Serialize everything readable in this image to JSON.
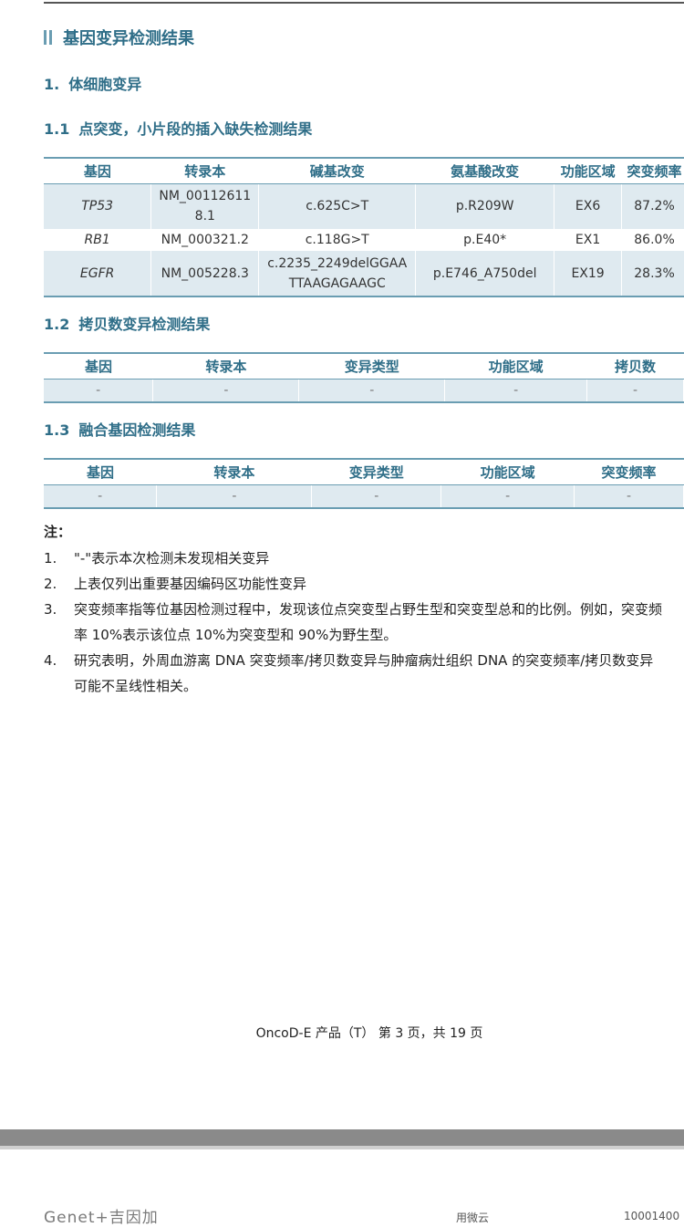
{
  "section_title": "基因变异检测结果",
  "somatic_heading": {
    "num": "1.",
    "label": "体细胞变异"
  },
  "snv": {
    "heading_num": "1.1",
    "heading_label": "点突变，小片段的插入缺失检测结果",
    "headers": [
      "基因",
      "转录本",
      "碱基改变",
      "氨基酸改变",
      "功能区域",
      "突变频率"
    ],
    "rows": [
      {
        "gene": "TP53",
        "transcript_line1": "NM_00112611",
        "transcript_line2": "8.1",
        "base_change_line1": "c.625C>T",
        "base_change_line2": "",
        "aa_change": "p.R209W",
        "region": "EX6",
        "freq": "87.2%"
      },
      {
        "gene": "RB1",
        "transcript_line1": "NM_000321.2",
        "transcript_line2": "",
        "base_change_line1": "c.118G>T",
        "base_change_line2": "",
        "aa_change": "p.E40*",
        "region": "EX1",
        "freq": "86.0%"
      },
      {
        "gene": "EGFR",
        "transcript_line1": "NM_005228.3",
        "transcript_line2": "",
        "base_change_line1": "c.2235_2249delGGAA",
        "base_change_line2": "TTAAGAGAAGC",
        "aa_change": "p.E746_A750del",
        "region": "EX19",
        "freq": "28.3%"
      }
    ]
  },
  "cnv": {
    "heading_num": "1.2",
    "heading_label": "拷贝数变异检测结果",
    "headers": [
      "基因",
      "转录本",
      "变异类型",
      "功能区域",
      "拷贝数"
    ],
    "row": [
      "-",
      "-",
      "-",
      "-",
      "-"
    ]
  },
  "fusion": {
    "heading_num": "1.3",
    "heading_label": "融合基因检测结果",
    "headers": [
      "基因",
      "转录本",
      "变异类型",
      "功能区域",
      "突变频率"
    ],
    "row": [
      "-",
      "-",
      "-",
      "-",
      "-"
    ]
  },
  "notes": {
    "title": "注：",
    "items": [
      {
        "num": "1.",
        "lines": [
          "\"-\"表示本次检测未发现相关变异"
        ]
      },
      {
        "num": "2.",
        "lines": [
          "上表仅列出重要基因编码区功能性变异"
        ]
      },
      {
        "num": "3.",
        "lines": [
          "突变频率指等位基因检测过程中，发现该位点突变型占野生型和突变型总和的比例。例如，突变频",
          "率 10%表示该位点 10%为突变型和 90%为野生型。"
        ]
      },
      {
        "num": "4.",
        "lines": [
          "研究表明，外周血游离 DNA 突变频率/拷贝数变异与肿瘤病灶组织 DNA 的突变频率/拷贝数变异",
          "可能不呈线性相关。"
        ]
      }
    ]
  },
  "footer": "OncoD-E 产品（T） 第 3 页，共 19 页",
  "next_page": {
    "logo": "Genet+吉因加",
    "text1": "用微云",
    "text2": "10001400"
  }
}
